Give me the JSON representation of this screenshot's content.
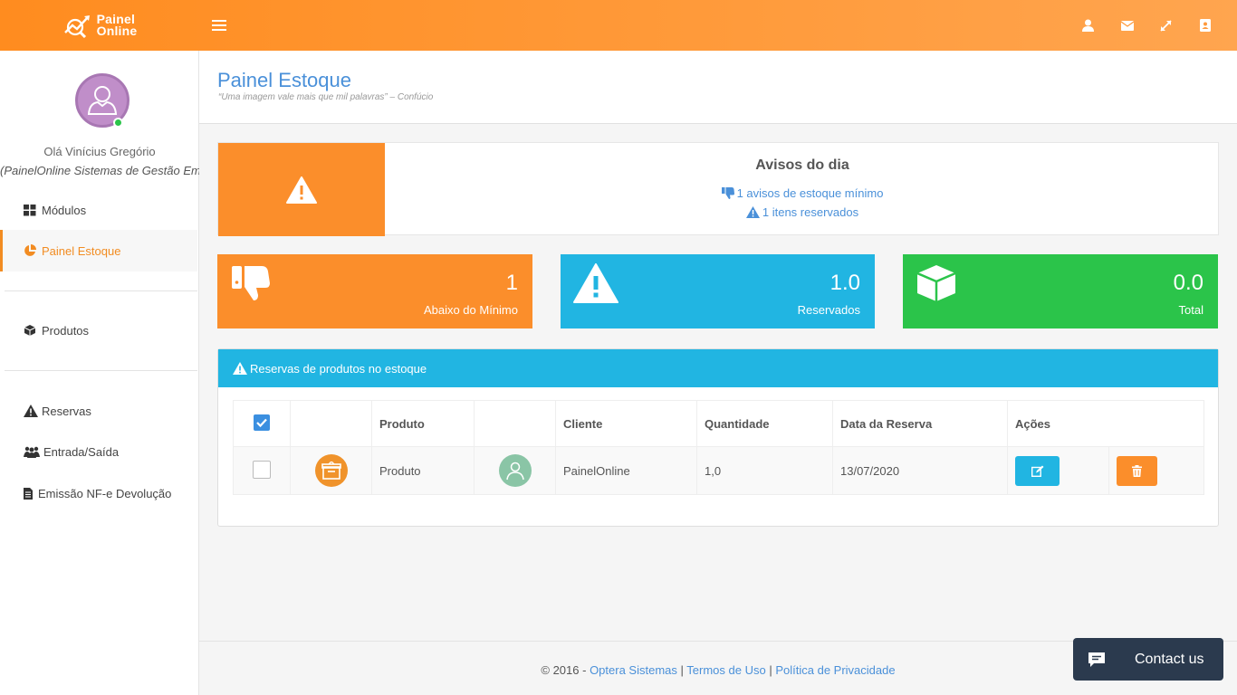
{
  "brand": {
    "line1": "Painel",
    "line2": "Online"
  },
  "topbar": {
    "icons": [
      "user-icon",
      "mail-icon",
      "expand-icon",
      "contacts-icon"
    ]
  },
  "user": {
    "greeting": "Olá Vinícius Gregório",
    "company": "(PainelOnline Sistemas de Gestão Empresarial)"
  },
  "sidebar": {
    "items": [
      {
        "label": "Módulos",
        "icon": "grid-icon"
      },
      {
        "label": "Painel Estoque",
        "icon": "pie-chart-icon",
        "active": true
      },
      {
        "label": "Produtos",
        "icon": "cube-icon"
      },
      {
        "label": "Reservas",
        "icon": "warning-icon"
      },
      {
        "label": "Entrada/Saída",
        "icon": "people-icon"
      },
      {
        "label": "Emissão NF-e Devolução",
        "icon": "document-icon"
      }
    ]
  },
  "page": {
    "title": "Painel Estoque",
    "subtitle": "“Uma imagem vale mais que mil palavras” – Confúcio"
  },
  "alerts": {
    "title": "Avisos do dia",
    "line1": "1 avisos de estoque mínimo",
    "line2": "1 itens reservados"
  },
  "stats": [
    {
      "value": "1",
      "label": "Abaixo do Mínimo",
      "color": "#fb8e2b"
    },
    {
      "value": "1.0",
      "label": "Reservados",
      "color": "#21b5e2"
    },
    {
      "value": "0.0",
      "label": "Total",
      "color": "#2bc44a"
    }
  ],
  "reservations": {
    "title": "Reservas de produtos no estoque",
    "headers": [
      "Produto",
      "Cliente",
      "Quantidade",
      "Data da Reserva",
      "Ações"
    ],
    "rows": [
      {
        "produto": "Produto",
        "cliente": "PainelOnline",
        "quantidade": "1,0",
        "data": "13/07/2020"
      }
    ]
  },
  "footer": {
    "copyright": "© 2016 -",
    "link1": "Optera Sistemas",
    "sep": "|",
    "link2": "Termos de Uso",
    "link3": "Política de Privacidade"
  },
  "contact": {
    "label": "Contact us"
  },
  "colors": {
    "accent": "#f28c22",
    "info": "#21b5e2",
    "success": "#2bc44a",
    "link": "#4a90d9"
  }
}
